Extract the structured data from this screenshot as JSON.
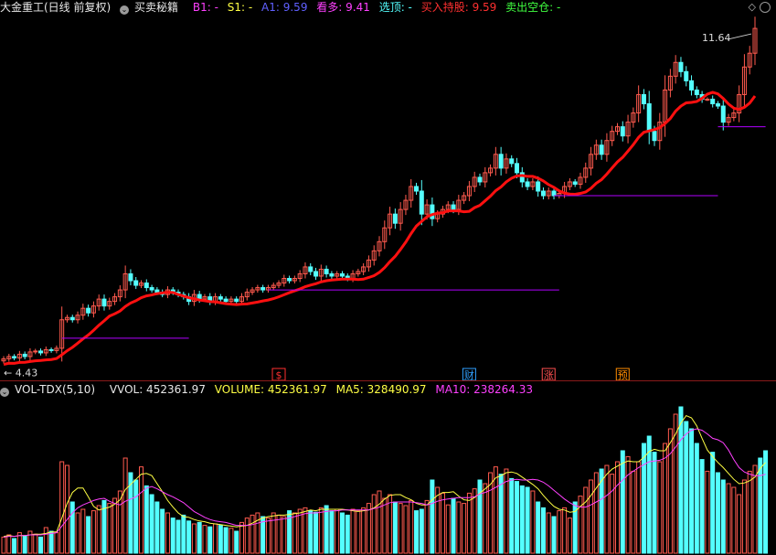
{
  "header": {
    "stock_title": "大金重工(日线 前复权)",
    "indicator_name": "买卖秘籍",
    "b1": "B1: -",
    "s1": "S1: -",
    "a1": "A1: 9.59",
    "kanduo": "看多: 9.41",
    "xuanding": "选顶: -",
    "mairu": "买入持股: 9.59",
    "maichu": "卖出空仓: -"
  },
  "price_panel": {
    "high_label": "11.64",
    "low_label": "4.43",
    "event_markers": [
      {
        "label": "$",
        "color": "#ff3030"
      },
      {
        "label": "财",
        "color": "#30a0ff"
      },
      {
        "label": "涨",
        "color": "#ff5050"
      },
      {
        "label": "预",
        "color": "#ff8c00"
      }
    ]
  },
  "volume_header": {
    "name": "VOL-TDX(5,10)",
    "vvol": "VVOL: 452361.97",
    "volume": "VOLUME: 452361.97",
    "ma5": "MA5: 328490.97",
    "ma10": "MA10: 238264.33"
  },
  "colors": {
    "up": "#ff5a4e",
    "down": "#54ffff",
    "ma_red": "#ff1010",
    "ma5": "#ffff44",
    "ma10": "#ff40ff",
    "support_line": "#b000ff"
  },
  "chart_data": [
    {
      "type": "candlestick",
      "title": "大金重工(日线 前复权)",
      "ylim": [
        4.3,
        11.9
      ],
      "annotations": [
        "11.64",
        "4.43"
      ],
      "close": [
        4.45,
        4.5,
        4.47,
        4.55,
        4.5,
        4.6,
        4.62,
        4.58,
        4.65,
        4.63,
        4.68,
        5.3,
        5.35,
        5.3,
        5.4,
        5.55,
        5.45,
        5.6,
        5.75,
        5.6,
        5.7,
        5.8,
        5.95,
        6.3,
        6.15,
        6.05,
        6.1,
        6.0,
        5.95,
        5.9,
        5.85,
        5.95,
        5.9,
        5.85,
        5.8,
        5.7,
        5.85,
        5.75,
        5.8,
        5.7,
        5.8,
        5.75,
        5.7,
        5.75,
        5.7,
        5.8,
        5.9,
        5.95,
        6.0,
        5.95,
        6.0,
        6.05,
        6.1,
        6.2,
        6.15,
        6.2,
        6.3,
        6.45,
        6.35,
        6.25,
        6.4,
        6.3,
        6.25,
        6.3,
        6.25,
        6.2,
        6.3,
        6.35,
        6.45,
        6.6,
        6.8,
        7.0,
        7.3,
        7.6,
        7.4,
        7.7,
        7.9,
        8.2,
        8.1,
        7.6,
        7.8,
        7.5,
        7.6,
        7.7,
        7.8,
        7.7,
        7.9,
        8.0,
        8.2,
        8.4,
        8.3,
        8.5,
        8.6,
        8.9,
        8.6,
        8.8,
        8.7,
        8.5,
        8.3,
        8.2,
        8.3,
        8.1,
        8.0,
        8.1,
        8.0,
        8.05,
        8.2,
        8.3,
        8.25,
        8.4,
        8.6,
        8.9,
        9.1,
        8.9,
        9.2,
        9.4,
        9.5,
        9.3,
        9.6,
        9.8,
        10.2,
        10.0,
        9.4,
        9.2,
        9.6,
        10.3,
        10.6,
        10.9,
        10.7,
        10.5,
        10.3,
        10.2,
        10.1,
        10.1,
        10.0,
        9.95,
        9.6,
        9.7,
        9.8,
        10.2,
        10.8,
        11.1,
        11.64
      ],
      "volume_series": [
        {
          "name": "VOLUME",
          "values": [
            22,
            25,
            20,
            28,
            24,
            30,
            26,
            22,
            35,
            30,
            28,
            125,
            120,
            70,
            55,
            60,
            50,
            58,
            65,
            72,
            68,
            75,
            85,
            130,
            110,
            100,
            118,
            92,
            80,
            70,
            60,
            55,
            48,
            45,
            52,
            44,
            40,
            42,
            38,
            36,
            40,
            38,
            35,
            34,
            30,
            42,
            48,
            52,
            55,
            50,
            48,
            55,
            52,
            50,
            58,
            55,
            60,
            62,
            58,
            56,
            62,
            65,
            58,
            60,
            55,
            52,
            60,
            58,
            62,
            68,
            80,
            85,
            75,
            80,
            70,
            68,
            65,
            72,
            58,
            60,
            72,
            100,
            90,
            82,
            66,
            75,
            70,
            68,
            82,
            88,
            100,
            95,
            110,
            118,
            108,
            115,
            102,
            98,
            92,
            90,
            85,
            70,
            62,
            55,
            50,
            58,
            62,
            48,
            70,
            78,
            90,
            100,
            110,
            115,
            120,
            108,
            125,
            140,
            132,
            112,
            125,
            150,
            160,
            138,
            125,
            150,
            170,
            190,
            200,
            180,
            170,
            150,
            128,
            112,
            138,
            110,
            100,
            95,
            90,
            80,
            100,
            112,
            120,
            130,
            140
          ]
        },
        {
          "name": "MA5",
          "values": [
            23,
            24,
            23,
            24,
            24,
            25,
            26,
            26,
            27,
            29,
            29,
            48,
            68,
            83,
            89,
            89,
            77,
            64,
            59,
            61,
            63,
            67,
            73,
            87,
            94,
            101,
            108,
            109,
            106,
            95,
            84,
            72,
            63,
            55,
            50,
            49,
            46,
            44,
            43,
            41,
            40,
            39,
            38,
            37,
            36,
            37,
            38,
            41,
            45,
            48,
            50,
            51,
            52,
            52,
            53,
            54,
            55,
            57,
            59,
            58,
            60,
            60,
            60,
            60,
            60,
            59,
            58,
            57,
            58,
            59,
            62,
            67,
            74,
            79,
            80,
            80,
            76,
            73,
            68,
            66,
            66,
            73,
            79,
            83,
            83,
            84,
            78,
            73,
            72,
            76,
            82,
            88,
            94,
            103,
            106,
            110,
            111,
            109,
            104,
            99,
            94,
            88,
            79,
            71,
            64,
            60,
            59,
            56,
            57,
            64,
            70,
            79,
            89,
            99,
            108,
            115,
            119,
            123,
            126,
            125,
            125,
            131,
            139,
            142,
            140,
            140,
            151,
            163,
            178,
            188,
            185,
            174,
            157,
            141,
            132,
            124,
            117,
            109,
            101,
            95,
            96,
            99,
            104,
            116,
            124
          ]
        },
        {
          "name": "MA10",
          "values": [
            22,
            23,
            23,
            24,
            24,
            25,
            25,
            25,
            26,
            27,
            28,
            37,
            46,
            55,
            62,
            66,
            69,
            72,
            74,
            75,
            71,
            68,
            66,
            71,
            74,
            77,
            83,
            89,
            91,
            88,
            84,
            80,
            77,
            73,
            69,
            63,
            57,
            53,
            49,
            46,
            44,
            43,
            42,
            40,
            38,
            38,
            38,
            39,
            41,
            43,
            44,
            45,
            46,
            47,
            48,
            50,
            52,
            54,
            55,
            55,
            56,
            57,
            58,
            58,
            59,
            59,
            59,
            59,
            59,
            59,
            61,
            63,
            66,
            69,
            70,
            70,
            70,
            70,
            69,
            68,
            66,
            68,
            71,
            73,
            74,
            75,
            76,
            76,
            76,
            77,
            81,
            83,
            86,
            90,
            94,
            98,
            100,
            101,
            100,
            100,
            101,
            100,
            97,
            92,
            86,
            80,
            74,
            69,
            65,
            63,
            63,
            66,
            70,
            74,
            79,
            85,
            93,
            100,
            107,
            112,
            117,
            121,
            125,
            126,
            127,
            130,
            136,
            145,
            155,
            163,
            168,
            170,
            168,
            163,
            157,
            155,
            151,
            141,
            128,
            117,
            111,
            108,
            106,
            106,
            108
          ]
        }
      ]
    }
  ]
}
